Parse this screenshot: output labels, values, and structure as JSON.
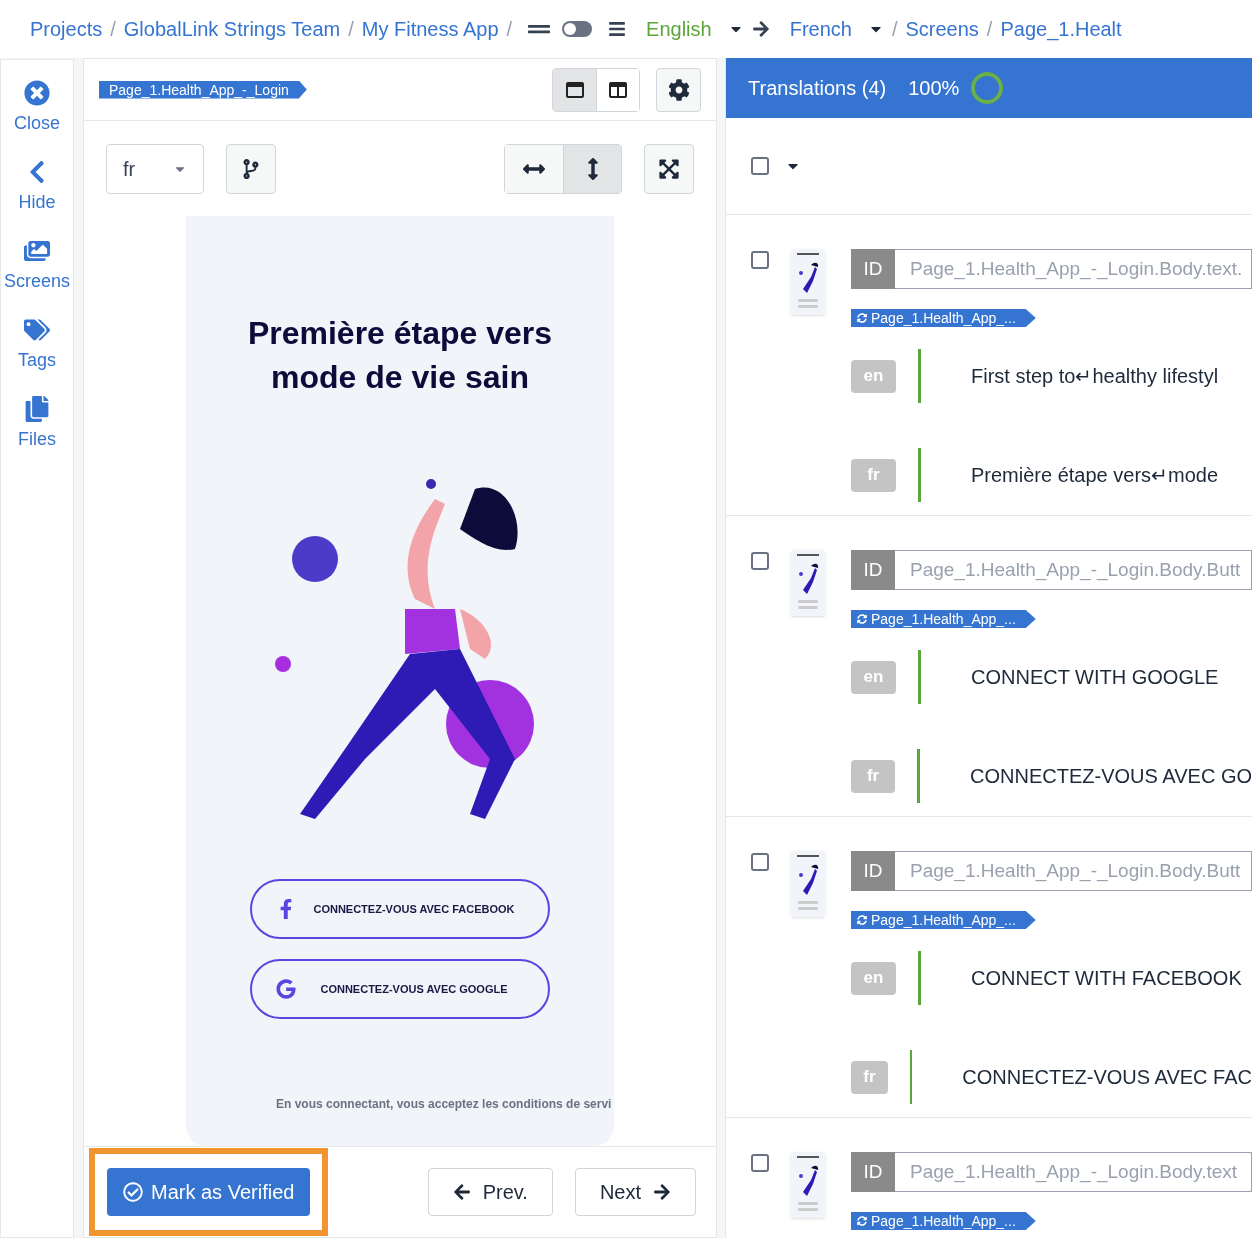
{
  "breadcrumb": {
    "separator": "/",
    "items": [
      {
        "label": "Projects"
      },
      {
        "label": "GlobalLink Strings Team"
      },
      {
        "label": "My Fitness App"
      }
    ],
    "toggle": {
      "on": false
    },
    "source_language": "English",
    "target_language": "French",
    "tail": [
      {
        "label": "Screens"
      },
      {
        "label": "Page_1.Healt"
      }
    ]
  },
  "sidebar": {
    "items": [
      {
        "kind": "close",
        "label": "Close"
      },
      {
        "kind": "hide",
        "label": "Hide"
      },
      {
        "kind": "screens",
        "label": "Screens"
      },
      {
        "kind": "tags",
        "label": "Tags"
      },
      {
        "kind": "files",
        "label": "Files"
      }
    ]
  },
  "editor": {
    "screen_tag": "Page_1.Health_App_-_Login",
    "layouts": [
      {
        "kind": "single",
        "selected": true
      },
      {
        "kind": "split",
        "selected": false
      }
    ],
    "language_select": "fr",
    "fit": [
      {
        "kind": "width",
        "selected": false
      },
      {
        "kind": "height",
        "selected": true
      }
    ],
    "preview": {
      "title": "Première étape vers mode de vie sain",
      "buttons": [
        {
          "kind": "facebook",
          "label": "CONNECTEZ-VOUS AVEC FACEBOOK"
        },
        {
          "kind": "google",
          "label": "CONNECTEZ-VOUS AVEC GOOGLE"
        }
      ],
      "footer": "En vous connectant, vous acceptez les conditions de servi"
    },
    "verify_button": "Mark as Verified",
    "prev_button": "Prev.",
    "next_button": "Next"
  },
  "translations": {
    "title": "Translations (4)",
    "percent": "100%",
    "level": 1,
    "select_all": {
      "checked": false
    },
    "rows": [
      {
        "checked": false,
        "id_label": "ID",
        "id": "Page_1.Health_App_-_Login.Body.text.",
        "tag": "Page_1.Health_App_...",
        "entries": [
          {
            "lang": "en",
            "text": "First step to↵healthy lifestyl"
          },
          {
            "lang": "fr",
            "text": "Première étape vers↵mode"
          }
        ]
      },
      {
        "checked": false,
        "id_label": "ID",
        "id": "Page_1.Health_App_-_Login.Body.Butt",
        "tag": "Page_1.Health_App_...",
        "entries": [
          {
            "lang": "en",
            "text": "CONNECT WITH GOOGLE"
          },
          {
            "lang": "fr",
            "text": "CONNECTEZ-VOUS AVEC GO"
          }
        ]
      },
      {
        "checked": false,
        "id_label": "ID",
        "id": "Page_1.Health_App_-_Login.Body.Butt",
        "tag": "Page_1.Health_App_...",
        "entries": [
          {
            "lang": "en",
            "text": "CONNECT WITH FACEBOOK"
          },
          {
            "lang": "fr",
            "text": "CONNECTEZ-VOUS AVEC FAC"
          }
        ]
      },
      {
        "checked": false,
        "id_label": "ID",
        "id": "Page_1.Health_App_-_Login.Body.text",
        "tag": "Page_1.Health_App_...",
        "entries": []
      }
    ]
  }
}
